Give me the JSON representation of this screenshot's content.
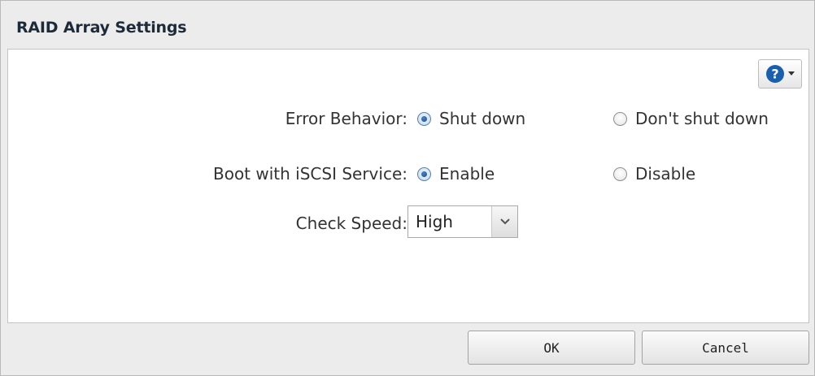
{
  "dialog": {
    "title": "RAID Array Settings"
  },
  "help": {
    "icon": "question-circle-icon",
    "dropdown_icon": "caret-down-icon",
    "accent": "#1a5fae"
  },
  "settings": {
    "error_behavior": {
      "label": "Error Behavior:",
      "options": [
        "Shut down",
        "Don't shut down"
      ],
      "selected": "Shut down"
    },
    "iscsi": {
      "label": "Boot with iSCSI Service:",
      "options": [
        "Enable",
        "Disable"
      ],
      "selected": "Enable"
    },
    "check_speed": {
      "label": "Check Speed:",
      "value": "High"
    }
  },
  "footer": {
    "ok_label": "OK",
    "cancel_label": "Cancel"
  }
}
